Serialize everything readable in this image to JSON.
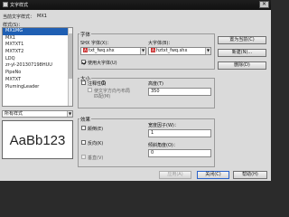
{
  "window": {
    "title": "文字样式"
  },
  "current_style": {
    "label": "当前文字样式：",
    "value": "MX1"
  },
  "styles": {
    "label": "样式(S)：",
    "items": [
      "MX1MG",
      "MX1",
      "MXTXT1",
      "MXTXT2",
      "LDQ",
      "zr-yl-201307198HUU",
      "PipeNo",
      "MXTXT",
      "PlumingLeader"
    ],
    "selected": "MX1MG",
    "filter_value": "所有样式"
  },
  "preview": {
    "text": "AaBb123"
  },
  "font": {
    "group_label": "字体",
    "shx_label": "SHX 字体(X)：",
    "shx_value": "txt_fwq.shx",
    "big_label": "大字体(B)：",
    "big_value": "hztxt_fwq.shx",
    "use_big_label": "使用大字体(U)",
    "use_big_checked": true
  },
  "size": {
    "group_label": "大小",
    "annotative_label": "注释性(I)",
    "annotative_checked": false,
    "match_label_line1": "使文字方向与布局",
    "match_label_line2": "匹配(M)",
    "height_label": "高度(T)",
    "height_value": "350"
  },
  "effects": {
    "group_label": "效果",
    "upside_down_label": "颠倒(E)",
    "backwards_label": "反向(K)",
    "vertical_label": "垂直(V)",
    "width_label": "宽度因子(W)：",
    "width_value": "1",
    "oblique_label": "倾斜角度(O)：",
    "oblique_value": "0"
  },
  "buttons": {
    "set_current": "置为当前(C)",
    "new": "新建(N)...",
    "delete": "删除(D)",
    "apply": "应用(A)",
    "close": "关闭(C)",
    "help": "帮助(H)"
  }
}
